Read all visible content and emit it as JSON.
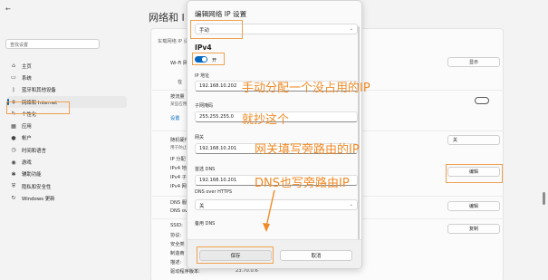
{
  "main": {
    "title": "网络和 I",
    "adapter_strip": "车载网络 IP 设置",
    "wifi_label": "Wi-Fi 网",
    "show_button": "显示",
    "check_label": "在",
    "metered_label": "按流量",
    "metered_sub": "某些应用",
    "set_label": "设置",
    "random_label": "随机硬件",
    "random_sub": "用于防止",
    "random_value": "关",
    "ip_labels": [
      "IP 分配",
      "IPv4 地",
      "IPv4 子",
      "IPv4 网"
    ],
    "edit_button_1": "编辑",
    "dns_label": "DNS 服",
    "dns_sub": "DNS ove",
    "edit_button_2": "编辑",
    "ssid_labels": [
      "SSID:",
      "协议:",
      "安全类",
      "制造商",
      "描述:"
    ],
    "driver_label": "驱动程序版本:",
    "driver_value": "23.70.0.6",
    "copy_button": "复制"
  },
  "sidebar": {
    "back": "←",
    "search_placeholder": "查找设置",
    "items": [
      {
        "label": "主页",
        "icon": "home-icon",
        "glyph": "⌂"
      },
      {
        "label": "系统",
        "icon": "system-icon",
        "glyph": "▭"
      },
      {
        "label": "蓝牙和其他设备",
        "icon": "bluetooth-icon",
        "glyph": "ᛒ"
      },
      {
        "label": "网络和 Internet",
        "icon": "network-icon",
        "glyph": "◈"
      },
      {
        "label": "个性化",
        "icon": "personalization-icon",
        "glyph": "✎"
      },
      {
        "label": "应用",
        "icon": "apps-icon",
        "glyph": "▦"
      },
      {
        "label": "帐户",
        "icon": "accounts-icon",
        "glyph": "●"
      },
      {
        "label": "时间和语言",
        "icon": "time-language-icon",
        "glyph": "◷"
      },
      {
        "label": "游戏",
        "icon": "gaming-icon",
        "glyph": "◉"
      },
      {
        "label": "辅助功能",
        "icon": "accessibility-icon",
        "glyph": "✱"
      },
      {
        "label": "隐私和安全性",
        "icon": "privacy-icon",
        "glyph": "⛨"
      },
      {
        "label": "Windows 更新",
        "icon": "windows-update-icon",
        "glyph": "↻"
      }
    ]
  },
  "dialog": {
    "title": "编辑网络 IP 设置",
    "mode": "手动",
    "ipv4_heading": "IPv4",
    "toggle_label": "开",
    "ip_label": "IP 地址",
    "ip_value": "192.168.10.202",
    "mask_label": "子网掩码",
    "mask_value": "255.255.255.0",
    "gateway_label": "网关",
    "gateway_value": "192.168.10.201",
    "dns_label": "首选 DNS",
    "dns_value": "192.168.10.201",
    "dns_https_label": "DNS over HTTPS",
    "dns_https_value": "关",
    "alt_dns_label": "备用 DNS",
    "save": "保存",
    "cancel": "取消"
  },
  "annotations": {
    "ip": "手动分配一个没占用的IP",
    "mask": "就抄这个",
    "gateway": "网关填写旁路由的IP",
    "dns": "DNS也写旁路由IP"
  },
  "colors": {
    "accent": "#0067c0",
    "annotation": "#f08a26"
  }
}
